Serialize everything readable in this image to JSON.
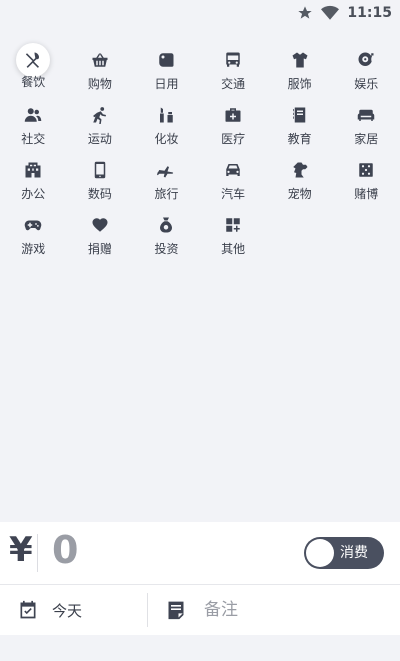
{
  "status": {
    "time": "11:15"
  },
  "categories": [
    {
      "label": "餐饮",
      "icon": "utensils-icon"
    },
    {
      "label": "购物",
      "icon": "basket-icon"
    },
    {
      "label": "日用",
      "icon": "toilet-paper-icon"
    },
    {
      "label": "交通",
      "icon": "bus-icon"
    },
    {
      "label": "服饰",
      "icon": "tshirt-icon"
    },
    {
      "label": "娱乐",
      "icon": "music-disc-icon"
    },
    {
      "label": "社交",
      "icon": "users-icon"
    },
    {
      "label": "运动",
      "icon": "running-icon"
    },
    {
      "label": "化妆",
      "icon": "cosmetics-icon"
    },
    {
      "label": "医疗",
      "icon": "medical-kit-icon"
    },
    {
      "label": "教育",
      "icon": "book-icon"
    },
    {
      "label": "家居",
      "icon": "sofa-icon"
    },
    {
      "label": "办公",
      "icon": "building-icon"
    },
    {
      "label": "数码",
      "icon": "phone-icon"
    },
    {
      "label": "旅行",
      "icon": "airplane-icon"
    },
    {
      "label": "汽车",
      "icon": "car-icon"
    },
    {
      "label": "宠物",
      "icon": "dog-icon"
    },
    {
      "label": "赌博",
      "icon": "dice-icon"
    },
    {
      "label": "游戏",
      "icon": "gamepad-icon"
    },
    {
      "label": "捐赠",
      "icon": "heart-icon"
    },
    {
      "label": "投资",
      "icon": "money-bag-icon"
    },
    {
      "label": "其他",
      "icon": "apps-icon"
    }
  ],
  "selected_index": 0,
  "entry": {
    "currency_symbol": "¥",
    "amount": "0",
    "type_label": "消费",
    "date_label": "今天",
    "note_placeholder": "备注"
  }
}
